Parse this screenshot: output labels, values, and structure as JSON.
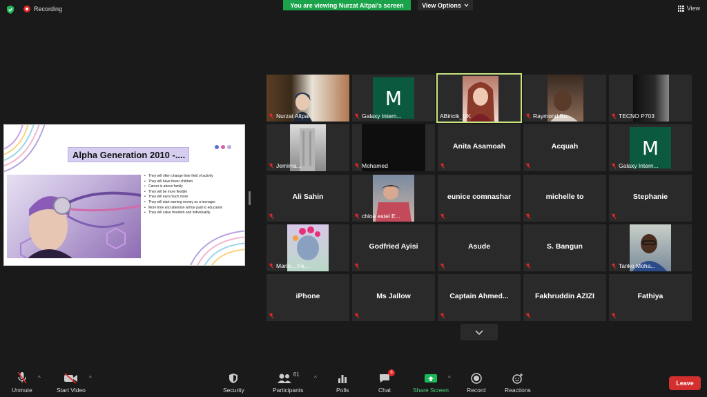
{
  "topbar": {
    "recording_label": "Recording",
    "viewing_banner": "You are viewing Nurzat Altpai's screen",
    "view_options": "View Options",
    "view_label": "View"
  },
  "slide": {
    "title": "Alpha Generation 2010 -....",
    "bullets": [
      "They will often change their field of activity",
      "They will have fewer children",
      "Career is above family",
      "They will be more flexible",
      "They will earn much more",
      "They will start earning money as a teenager",
      "More time and attention will be paid to education",
      "They will value freedom and individuality"
    ]
  },
  "participants": [
    {
      "name": "Nurzat Altpai"
    },
    {
      "name": "Galaxy Intern...",
      "avatar": "M"
    },
    {
      "name": "ABiricik_UK"
    },
    {
      "name": "Raymond Bo..."
    },
    {
      "name": "TECNO P703"
    },
    {
      "name": "Jemima..."
    },
    {
      "name": "Mohamed"
    },
    {
      "name": "Anita Asamoah"
    },
    {
      "name": "Acquah"
    },
    {
      "name": "Galaxy Intern...",
      "avatar": "M"
    },
    {
      "name": "Ali Sahin"
    },
    {
      "name": "chloe estel E..."
    },
    {
      "name": "eunice comnashar"
    },
    {
      "name": "michelle to"
    },
    {
      "name": "Stephanie"
    },
    {
      "name": "Mario... Fe..."
    },
    {
      "name": "Godfried Ayisi"
    },
    {
      "name": "Asude"
    },
    {
      "name": "S. Bangun"
    },
    {
      "name": "Tanko Moha..."
    },
    {
      "name": "iPhone"
    },
    {
      "name": "Ms Jallow"
    },
    {
      "name": "Captain  Ahmed..."
    },
    {
      "name": "Fakhruddin AZIZI"
    },
    {
      "name": "Fathiya"
    }
  ],
  "toolbar": {
    "unmute": "Unmute",
    "start_video": "Start Video",
    "security": "Security",
    "participants": "Participants",
    "participants_count": "61",
    "polls": "Polls",
    "chat": "Chat",
    "chat_badge": "8",
    "share_screen": "Share Screen",
    "record": "Record",
    "reactions": "Reactions",
    "leave": "Leave"
  },
  "colors": {
    "banner_green": "#1aa34a",
    "active_speaker": "#c7e37d",
    "leave_red": "#d32f2f",
    "avatar_green": "#0b5a3f"
  }
}
